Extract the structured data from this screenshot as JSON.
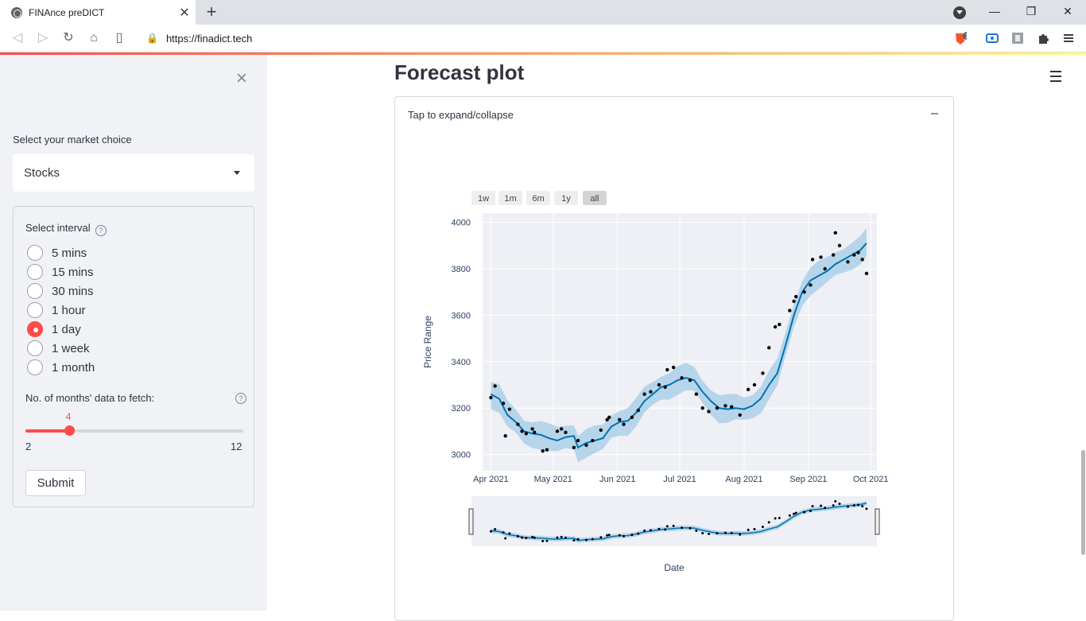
{
  "browser": {
    "tab_title": "FINAnce preDICT",
    "url": "https://finadict.tech",
    "tab_close": "✕",
    "new_tab": "+",
    "ext_badge": "1"
  },
  "sidebar": {
    "close": "×",
    "market_label": "Select your market choice",
    "market_value": "Stocks",
    "interval_label": "Select interval",
    "interval_options": [
      "5 mins",
      "15 mins",
      "30 mins",
      "1 hour",
      "1 day",
      "1 week",
      "1 month"
    ],
    "interval_selected": "1 day",
    "months_label": "No. of months' data to fetch:",
    "months_value": "4",
    "months_min": "2",
    "months_max": "12",
    "months_fraction": 0.2,
    "submit_label": "Submit"
  },
  "main": {
    "title": "Forecast plot",
    "expander_label": "Tap to expand/collapse",
    "expander_toggle": "–"
  },
  "chart_data": {
    "type": "line",
    "range_buttons": [
      "1w",
      "1m",
      "6m",
      "1y",
      "all"
    ],
    "range_selected": "all",
    "xlabel": "Date",
    "ylabel": "Price Range",
    "x_ticks": [
      "Apr 2021",
      "May 2021",
      "Jun 2021",
      "Jul 2021",
      "Aug 2021",
      "Sep 2021",
      "Oct 2021"
    ],
    "y_ticks": [
      3000,
      3200,
      3400,
      3600,
      3800,
      4000
    ],
    "ylim": [
      2930,
      4040
    ],
    "xlim": [
      "2021-03-28",
      "2021-10-04"
    ],
    "colors": {
      "forecast": "#0072b2",
      "band": "#b7d5ea",
      "actual": "#000000",
      "plot_bg": "#eef0f5"
    },
    "forecast": [
      [
        "2021-04-01",
        3260
      ],
      [
        "2021-04-05",
        3240
      ],
      [
        "2021-04-09",
        3170
      ],
      [
        "2021-04-13",
        3140
      ],
      [
        "2021-04-17",
        3100
      ],
      [
        "2021-04-21",
        3090
      ],
      [
        "2021-04-25",
        3085
      ],
      [
        "2021-04-29",
        3070
      ],
      [
        "2021-05-03",
        3060
      ],
      [
        "2021-05-07",
        3075
      ],
      [
        "2021-05-11",
        3080
      ],
      [
        "2021-05-13",
        3030
      ],
      [
        "2021-05-17",
        3050
      ],
      [
        "2021-05-21",
        3060
      ],
      [
        "2021-05-25",
        3070
      ],
      [
        "2021-05-29",
        3120
      ],
      [
        "2021-06-02",
        3140
      ],
      [
        "2021-06-06",
        3145
      ],
      [
        "2021-06-10",
        3180
      ],
      [
        "2021-06-14",
        3230
      ],
      [
        "2021-06-18",
        3260
      ],
      [
        "2021-06-22",
        3290
      ],
      [
        "2021-06-26",
        3300
      ],
      [
        "2021-06-30",
        3320
      ],
      [
        "2021-07-04",
        3330
      ],
      [
        "2021-07-08",
        3320
      ],
      [
        "2021-07-12",
        3270
      ],
      [
        "2021-07-16",
        3230
      ],
      [
        "2021-07-20",
        3200
      ],
      [
        "2021-07-24",
        3195
      ],
      [
        "2021-07-28",
        3200
      ],
      [
        "2021-08-01",
        3195
      ],
      [
        "2021-08-05",
        3210
      ],
      [
        "2021-08-09",
        3240
      ],
      [
        "2021-08-13",
        3300
      ],
      [
        "2021-08-17",
        3350
      ],
      [
        "2021-08-21",
        3470
      ],
      [
        "2021-08-25",
        3600
      ],
      [
        "2021-08-29",
        3700
      ],
      [
        "2021-09-02",
        3750
      ],
      [
        "2021-09-06",
        3770
      ],
      [
        "2021-09-10",
        3790
      ],
      [
        "2021-09-14",
        3820
      ],
      [
        "2021-09-18",
        3840
      ],
      [
        "2021-09-22",
        3860
      ],
      [
        "2021-09-26",
        3880
      ],
      [
        "2021-09-29",
        3910
      ]
    ],
    "actual": [
      [
        "2021-04-01",
        3245
      ],
      [
        "2021-04-03",
        3295
      ],
      [
        "2021-04-07",
        3220
      ],
      [
        "2021-04-08",
        3080
      ],
      [
        "2021-04-10",
        3195
      ],
      [
        "2021-04-14",
        3130
      ],
      [
        "2021-04-16",
        3100
      ],
      [
        "2021-04-18",
        3090
      ],
      [
        "2021-04-21",
        3110
      ],
      [
        "2021-04-22",
        3095
      ],
      [
        "2021-04-26",
        3015
      ],
      [
        "2021-04-28",
        3020
      ],
      [
        "2021-05-03",
        3100
      ],
      [
        "2021-05-05",
        3110
      ],
      [
        "2021-05-07",
        3095
      ],
      [
        "2021-05-11",
        3030
      ],
      [
        "2021-05-13",
        3060
      ],
      [
        "2021-05-17",
        3040
      ],
      [
        "2021-05-20",
        3060
      ],
      [
        "2021-05-24",
        3105
      ],
      [
        "2021-05-27",
        3150
      ],
      [
        "2021-05-28",
        3160
      ],
      [
        "2021-06-02",
        3150
      ],
      [
        "2021-06-04",
        3130
      ],
      [
        "2021-06-08",
        3160
      ],
      [
        "2021-06-11",
        3190
      ],
      [
        "2021-06-14",
        3260
      ],
      [
        "2021-06-17",
        3270
      ],
      [
        "2021-06-21",
        3300
      ],
      [
        "2021-06-24",
        3290
      ],
      [
        "2021-06-25",
        3365
      ],
      [
        "2021-06-28",
        3375
      ],
      [
        "2021-07-02",
        3330
      ],
      [
        "2021-07-06",
        3320
      ],
      [
        "2021-07-09",
        3260
      ],
      [
        "2021-07-12",
        3200
      ],
      [
        "2021-07-15",
        3185
      ],
      [
        "2021-07-19",
        3200
      ],
      [
        "2021-07-23",
        3210
      ],
      [
        "2021-07-26",
        3205
      ],
      [
        "2021-07-30",
        3170
      ],
      [
        "2021-08-03",
        3280
      ],
      [
        "2021-08-06",
        3300
      ],
      [
        "2021-08-10",
        3350
      ],
      [
        "2021-08-13",
        3460
      ],
      [
        "2021-08-16",
        3550
      ],
      [
        "2021-08-18",
        3560
      ],
      [
        "2021-08-23",
        3620
      ],
      [
        "2021-08-25",
        3660
      ],
      [
        "2021-08-26",
        3680
      ],
      [
        "2021-08-30",
        3700
      ],
      [
        "2021-09-02",
        3730
      ],
      [
        "2021-09-03",
        3840
      ],
      [
        "2021-09-07",
        3850
      ],
      [
        "2021-09-09",
        3800
      ],
      [
        "2021-09-13",
        3860
      ],
      [
        "2021-09-14",
        3955
      ],
      [
        "2021-09-16",
        3900
      ],
      [
        "2021-09-20",
        3830
      ],
      [
        "2021-09-23",
        3860
      ],
      [
        "2021-09-25",
        3870
      ],
      [
        "2021-09-27",
        3840
      ],
      [
        "2021-09-29",
        3780
      ]
    ],
    "band_halfwidth": 55
  }
}
